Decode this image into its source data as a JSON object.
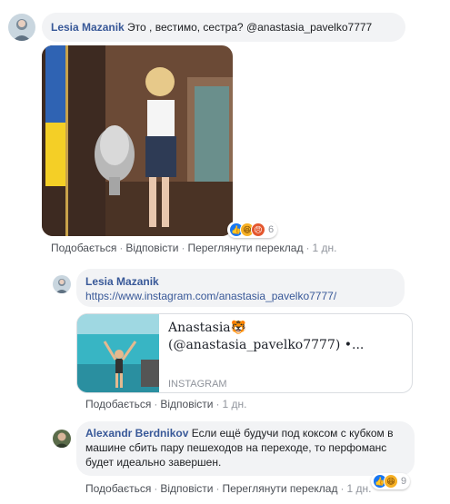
{
  "comment1": {
    "author": "Lesia Mazanik",
    "text": "Это , вестимо, сестра? @anastasia_pavelko7777",
    "reactions_count": "6",
    "actions": {
      "like": "Подобається",
      "reply": "Відповісти",
      "translate": "Переглянути переклад",
      "time": "1 дн."
    }
  },
  "reply1": {
    "author": "Lesia Mazanik",
    "link": "https://www.instagram.com/anastasia_pavelko7777/",
    "preview": {
      "title_line1": "Anastasia🐯",
      "title_line2": "(@anastasia_pavelko7777) •...",
      "source": "INSTAGRAM"
    },
    "actions": {
      "like": "Подобається",
      "reply": "Відповісти",
      "time": "1 дн."
    }
  },
  "reply2": {
    "author": "Alexandr Berdnikov",
    "text": "Если ещё будучи под коксом с кубком в машине сбить пару пешеходов на переходе, то перфоманс будет идеально завершен.",
    "reactions_count": "9",
    "actions": {
      "like": "Подобається",
      "reply": "Відповісти",
      "translate": "Переглянути переклад",
      "time": "1 дн."
    }
  },
  "colors": {
    "link": "#385898",
    "bubble": "#f2f3f5",
    "like": "#1877f2"
  },
  "icons": [
    "like-reaction-icon",
    "haha-reaction-icon",
    "angry-reaction-icon"
  ]
}
